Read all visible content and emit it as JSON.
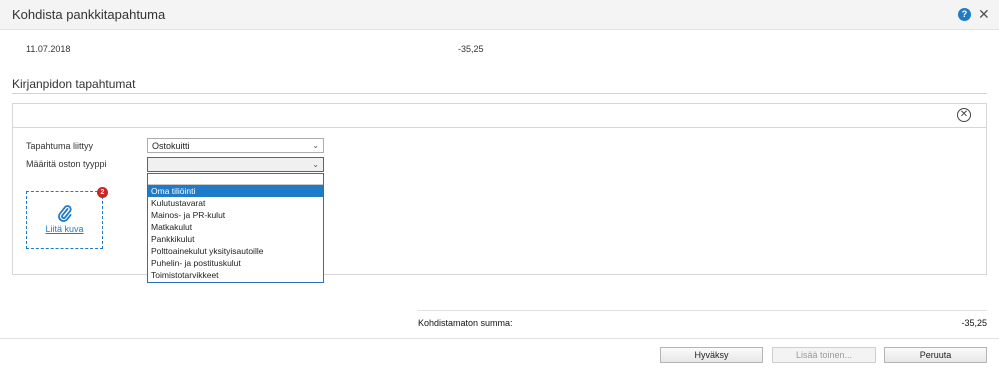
{
  "dialog": {
    "title": "Kohdista pankkitapahtuma"
  },
  "transaction": {
    "date": "11.07.2018",
    "amount": "-35,25"
  },
  "section": {
    "title": "Kirjanpidon tapahtumat"
  },
  "form": {
    "relates_label": "Tapahtuma liittyy",
    "relates_value": "Ostokuitti",
    "purchase_type_label": "Määritä oston tyyppi",
    "purchase_type_value": ""
  },
  "dropdown": {
    "items": [
      "Oma tiliöinti",
      "Kulutustavarat",
      "Mainos- ja PR-kulut",
      "Matkakulut",
      "Pankkikulut",
      "Polttoainekulut yksityisautoille",
      "Puhelin- ja postituskulut",
      "Toimistotarvikkeet"
    ],
    "highlighted_index": 0
  },
  "attachment": {
    "link_label": "Liitä kuva",
    "badge_count": "2"
  },
  "summary": {
    "label": "Kohdistamaton summa:",
    "value": "-35,25"
  },
  "buttons": {
    "approve": "Hyväksy",
    "add_another": "Lisää toinen...",
    "cancel": "Peruuta"
  },
  "icons": {
    "help": "help-icon",
    "close": "close-icon",
    "remove": "circle-close-icon",
    "attach": "paperclip-icon",
    "chevron": "chevron-down-icon"
  },
  "colors": {
    "accent": "#1f7bc8",
    "badge": "#c62828"
  }
}
